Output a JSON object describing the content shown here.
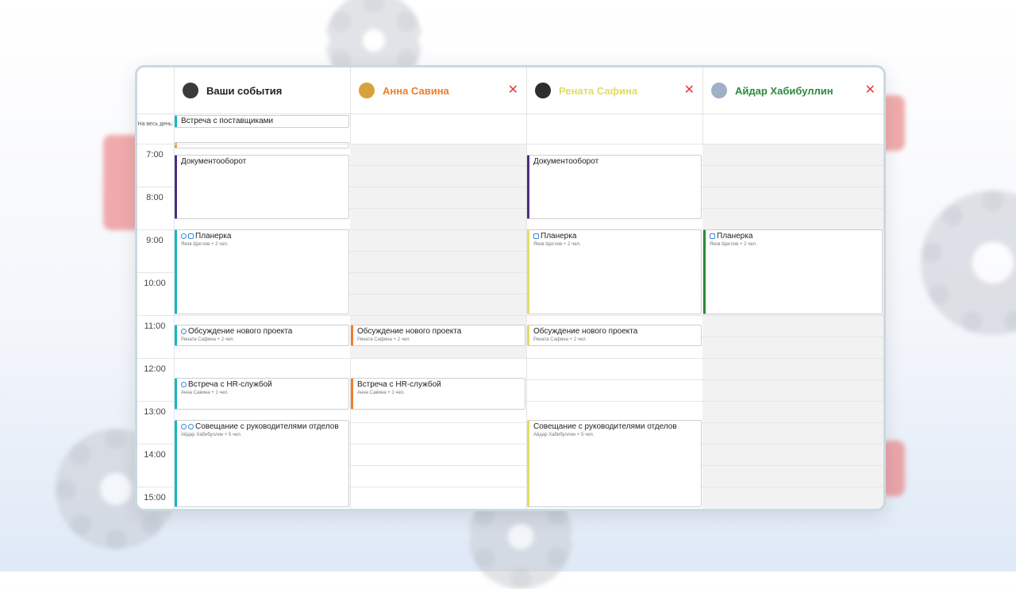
{
  "columns": [
    {
      "name": "Ваши события",
      "color": "#222222",
      "closable": false
    },
    {
      "name": "Анна Савина",
      "color": "#f07c2d",
      "closable": true
    },
    {
      "name": "Рената Сафина",
      "color": "#e1dc64",
      "closable": true
    },
    {
      "name": "Айдар Хабибуллин",
      "color": "#2c8a3b",
      "closable": true
    }
  ],
  "close_glyph": "✕",
  "allday_label": "На весь день:",
  "times": [
    "7:00",
    "8:00",
    "9:00",
    "10:00",
    "11:00",
    "12:00",
    "13:00",
    "14:00",
    "15:00"
  ],
  "events": {
    "supplier": {
      "title": "Встреча с поставщиками"
    },
    "docs": {
      "title": "Документооборот"
    },
    "planerka": {
      "title": "Планерка",
      "sub": "Яков Щеглов + 2 чел."
    },
    "project": {
      "title": "Обсуждение нового проекта",
      "sub": "Рената Сафина + 2 чел."
    },
    "hr": {
      "title": "Встреча с HR-службой",
      "sub": "Анна Савина + 1 чел."
    },
    "heads": {
      "title": "Совещание с руководителями отделов",
      "sub": "Айдар Хабибуллин + 5 чел."
    }
  },
  "colors": {
    "teal": "#17b6c6",
    "orange": "#f07c2d",
    "yellow": "#e1dc64",
    "green": "#2c8a3b",
    "purple": "#4b2d83"
  },
  "icons": [
    "clock-icon",
    "copy-icon",
    "plus-circle-icon",
    "close-icon",
    "avatar"
  ]
}
